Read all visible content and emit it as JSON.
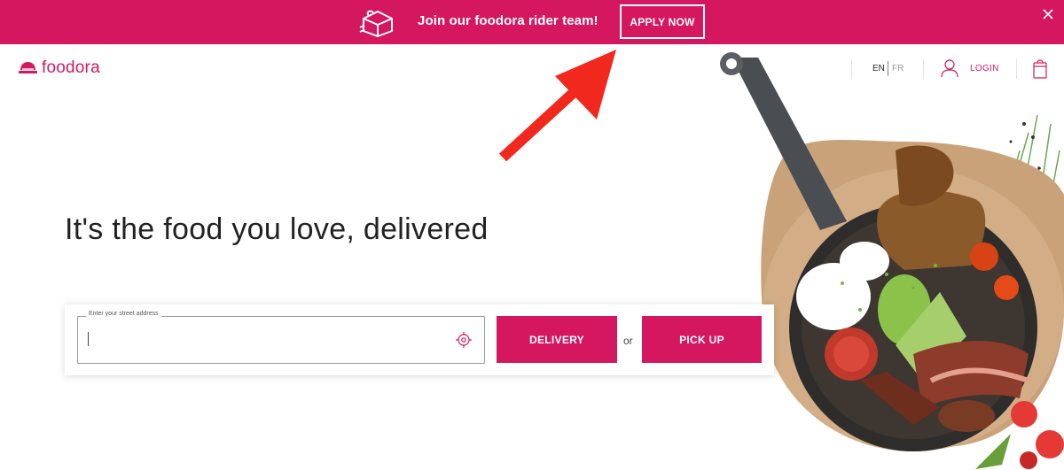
{
  "banner": {
    "text": "Join our foodora rider team!",
    "apply_label": "APPLY NOW",
    "icon": "delivery-box-icon",
    "close_icon": "close-icon"
  },
  "header": {
    "logo_text": "foodora",
    "logo_icon": "cloche-icon",
    "lang_en": "EN",
    "lang_fr": "FR",
    "login_label": "LOGIN",
    "user_icon": "user-icon",
    "cart_icon": "shopping-bag-icon"
  },
  "hero": {
    "headline": "It's the food you love, delivered",
    "address_label": "Enter your street address",
    "address_value": "",
    "locate_icon": "locate-target-icon",
    "delivery_label": "DELIVERY",
    "or_text": "or",
    "pickup_label": "PICK UP"
  },
  "colors": {
    "brand": "#d4175f",
    "arrow": "#f0281e"
  }
}
